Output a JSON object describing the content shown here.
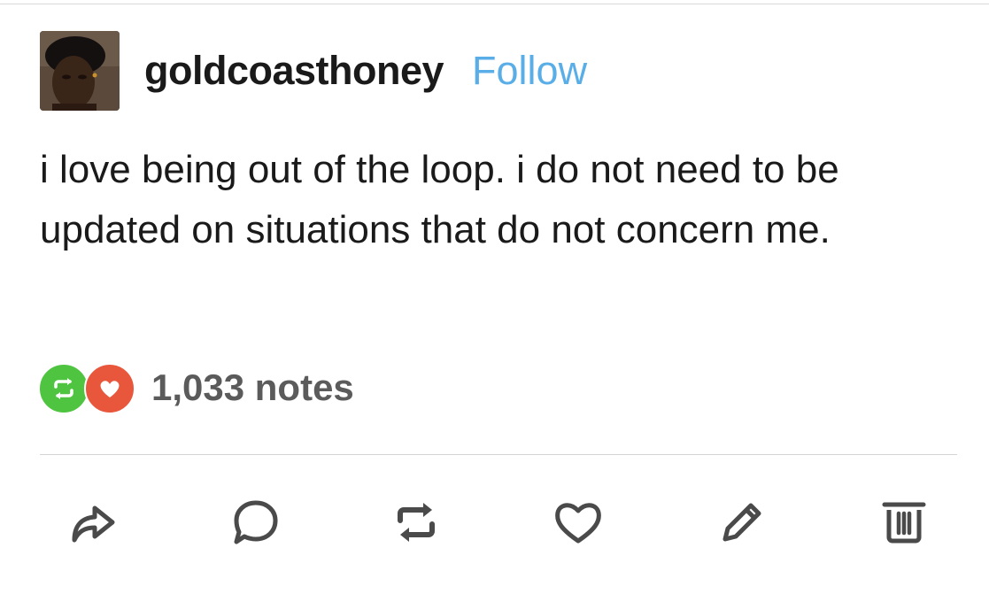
{
  "post": {
    "username": "goldcoasthoney",
    "follow_label": "Follow",
    "body": "i love being out of the loop. i do not need to be updated on situations that do not concern me."
  },
  "notes": {
    "count_label": "1,033 notes",
    "badges": [
      "reblog-icon",
      "heart-icon"
    ]
  },
  "actions": [
    {
      "name": "share",
      "icon": "share-arrow-icon"
    },
    {
      "name": "reply",
      "icon": "speech-bubble-icon"
    },
    {
      "name": "reblog",
      "icon": "reblog-icon"
    },
    {
      "name": "like",
      "icon": "heart-icon"
    },
    {
      "name": "edit",
      "icon": "pencil-icon"
    },
    {
      "name": "delete",
      "icon": "trash-icon"
    }
  ],
  "colors": {
    "follow": "#5aaee8",
    "reblog_badge": "#4fc440",
    "like_badge": "#e8573c",
    "icon_gray": "#4a4a4a"
  }
}
